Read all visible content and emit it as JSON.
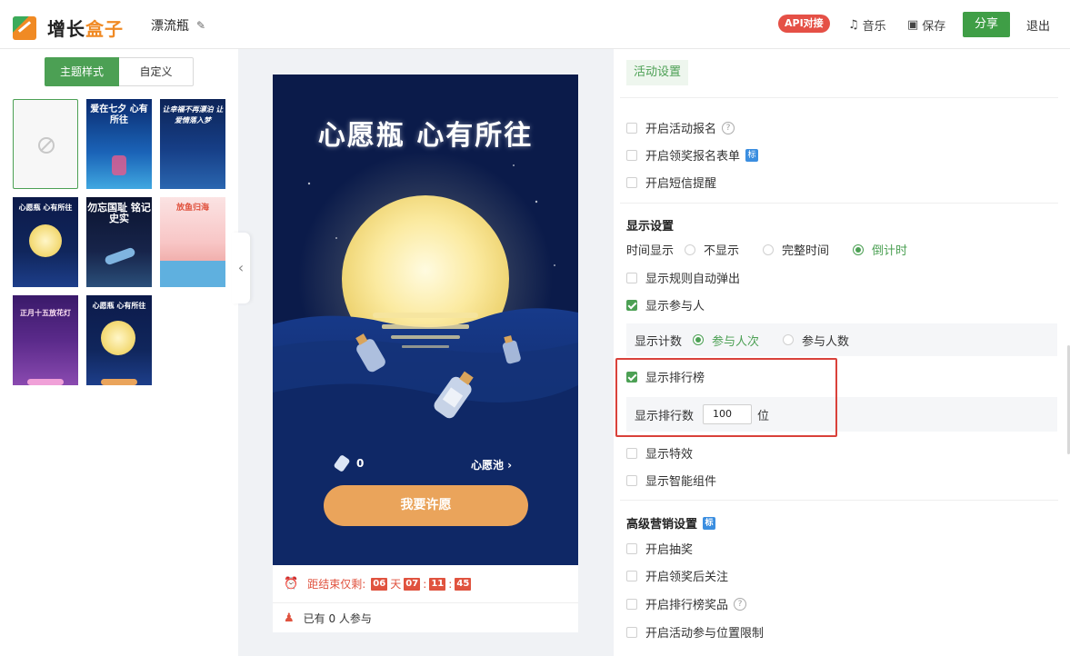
{
  "header": {
    "logo_text_a": "增长",
    "logo_text_b": "盒子",
    "doc_title": "漂流瓶",
    "api_badge": "API对接",
    "music_label": "音乐",
    "save_label": "保存",
    "share_label": "分享",
    "exit_label": "退出"
  },
  "left": {
    "tabs": [
      "主题样式",
      "自定义"
    ],
    "thumbnails": [
      {
        "id": "none",
        "text": ""
      },
      {
        "id": "t1",
        "text": "爱在七夕 心有所往"
      },
      {
        "id": "t2",
        "text": "让幸福不再漂泊 让爱情落入梦"
      },
      {
        "id": "t3",
        "text": "心愿瓶 心有所往"
      },
      {
        "id": "t4",
        "text": "勿忘国耻 铭记史实"
      },
      {
        "id": "t5",
        "text": "放鱼归海"
      },
      {
        "id": "t6",
        "text": "正月十五放花灯"
      },
      {
        "id": "t7",
        "text": "心愿瓶 心有所往"
      }
    ]
  },
  "preview": {
    "title": "心愿瓶 心有所往",
    "bottle_count": "0",
    "wish_pool": "心愿池 ›",
    "wish_button": "我要许愿",
    "countdown_label": "距结束仅剩:",
    "countdown": {
      "days": "06",
      "day_unit": "天",
      "hours": "07",
      "minutes": "11",
      "seconds": "45"
    },
    "participants": "已有 0 人参与"
  },
  "settings": {
    "activity_tag": "活动设置",
    "activity_options": [
      {
        "label": "开启活动报名",
        "checked": false
      },
      {
        "label": "开启领奖报名表单",
        "checked": false
      },
      {
        "label": "开启短信提醒",
        "checked": false
      }
    ],
    "display_title": "显示设置",
    "time_display_label": "时间显示",
    "time_options": [
      "不显示",
      "完整时间",
      "倒计时"
    ],
    "time_selected": "倒计时",
    "show_rules_popup": "显示规则自动弹出",
    "show_participants": "显示参与人",
    "count_label": "显示计数",
    "count_options": [
      "参与人次",
      "参与人数"
    ],
    "count_selected": "参与人次",
    "show_ranking": "显示排行榜",
    "ranking_count_label": "显示排行数",
    "ranking_count_value": "100",
    "ranking_unit": "位",
    "show_effects": "显示特效",
    "show_smart_widget": "显示智能组件",
    "advanced_title": "高级营销设置",
    "advanced_options": [
      {
        "label": "开启抽奖"
      },
      {
        "label": "开启领奖后关注"
      },
      {
        "label": "开启排行榜奖品"
      },
      {
        "label": "开启活动参与位置限制"
      }
    ],
    "tag_badge": "标"
  },
  "colors": {
    "brand_green": "#4ca054",
    "accent_orange": "#f08a24",
    "alert_red": "#d9413a",
    "wish_button": "#eaa45b",
    "poster_bg": "#0b1b4a"
  }
}
